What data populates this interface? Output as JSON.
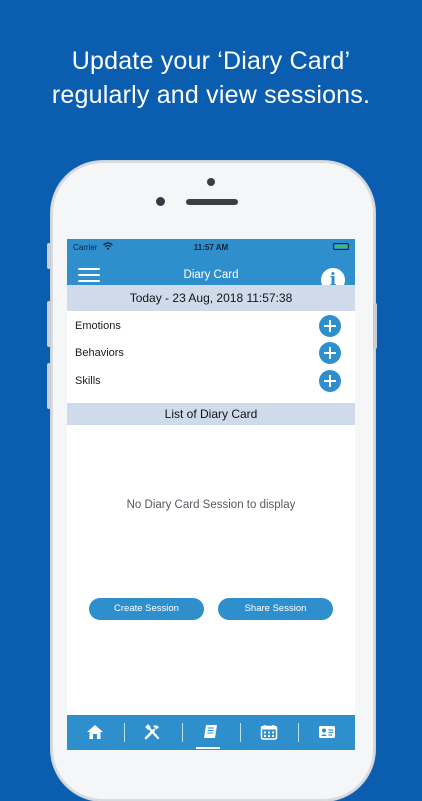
{
  "headline": {
    "line1": "Update your ‘Diary Card’",
    "line2": "regularly and view sessions."
  },
  "status_bar": {
    "carrier": "Carrier",
    "time": "11:57 AM"
  },
  "nav": {
    "title": "Diary Card",
    "info_label": "i"
  },
  "today": {
    "text": "Today - 23 Aug, 2018 11:57:38"
  },
  "rows": [
    {
      "label": "Emotions"
    },
    {
      "label": "Behaviors"
    },
    {
      "label": "Skills"
    }
  ],
  "list": {
    "header": "List of Diary Card",
    "empty_message": "No Diary Card Session to display"
  },
  "buttons": {
    "create": "Create Session",
    "share": "Share Session"
  },
  "tabs": [
    {
      "icon": "home-icon"
    },
    {
      "icon": "tools-icon"
    },
    {
      "icon": "book-icon"
    },
    {
      "icon": "calendar-icon"
    },
    {
      "icon": "id-card-icon"
    }
  ],
  "colors": {
    "background": "#0b5db0",
    "accent": "#2f8fcd",
    "section_header": "#cfdbea"
  }
}
